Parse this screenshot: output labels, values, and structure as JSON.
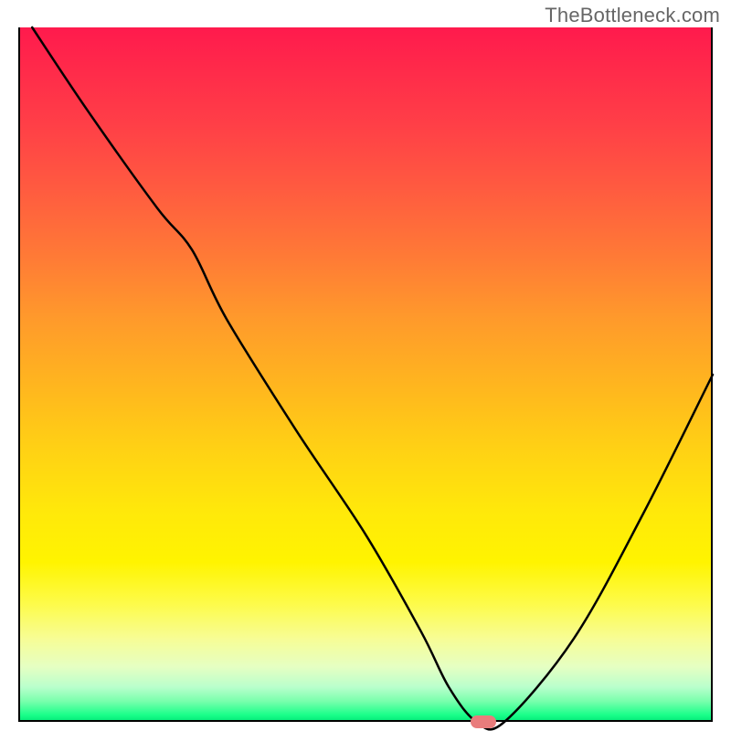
{
  "watermark": "TheBottleneck.com",
  "chart_data": {
    "type": "line",
    "title": "",
    "xlabel": "",
    "ylabel": "",
    "xlim": [
      0,
      100
    ],
    "ylim": [
      0,
      100
    ],
    "grid": false,
    "series": [
      {
        "name": "bottleneck-curve",
        "x": [
          2,
          10,
          20,
          25,
          30,
          40,
          50,
          58,
          62,
          66,
          70,
          80,
          90,
          100
        ],
        "y": [
          100,
          88,
          74,
          68,
          58,
          42,
          27,
          13,
          5,
          0,
          0,
          12,
          30,
          50
        ]
      }
    ],
    "marker": {
      "x": 67,
      "y": 0,
      "color": "#e97c7c"
    },
    "gradient_stops": [
      {
        "pct": 0,
        "color": "#ff1a4d"
      },
      {
        "pct": 50,
        "color": "#ffb71e"
      },
      {
        "pct": 80,
        "color": "#fff400"
      },
      {
        "pct": 100,
        "color": "#00e676"
      }
    ]
  }
}
